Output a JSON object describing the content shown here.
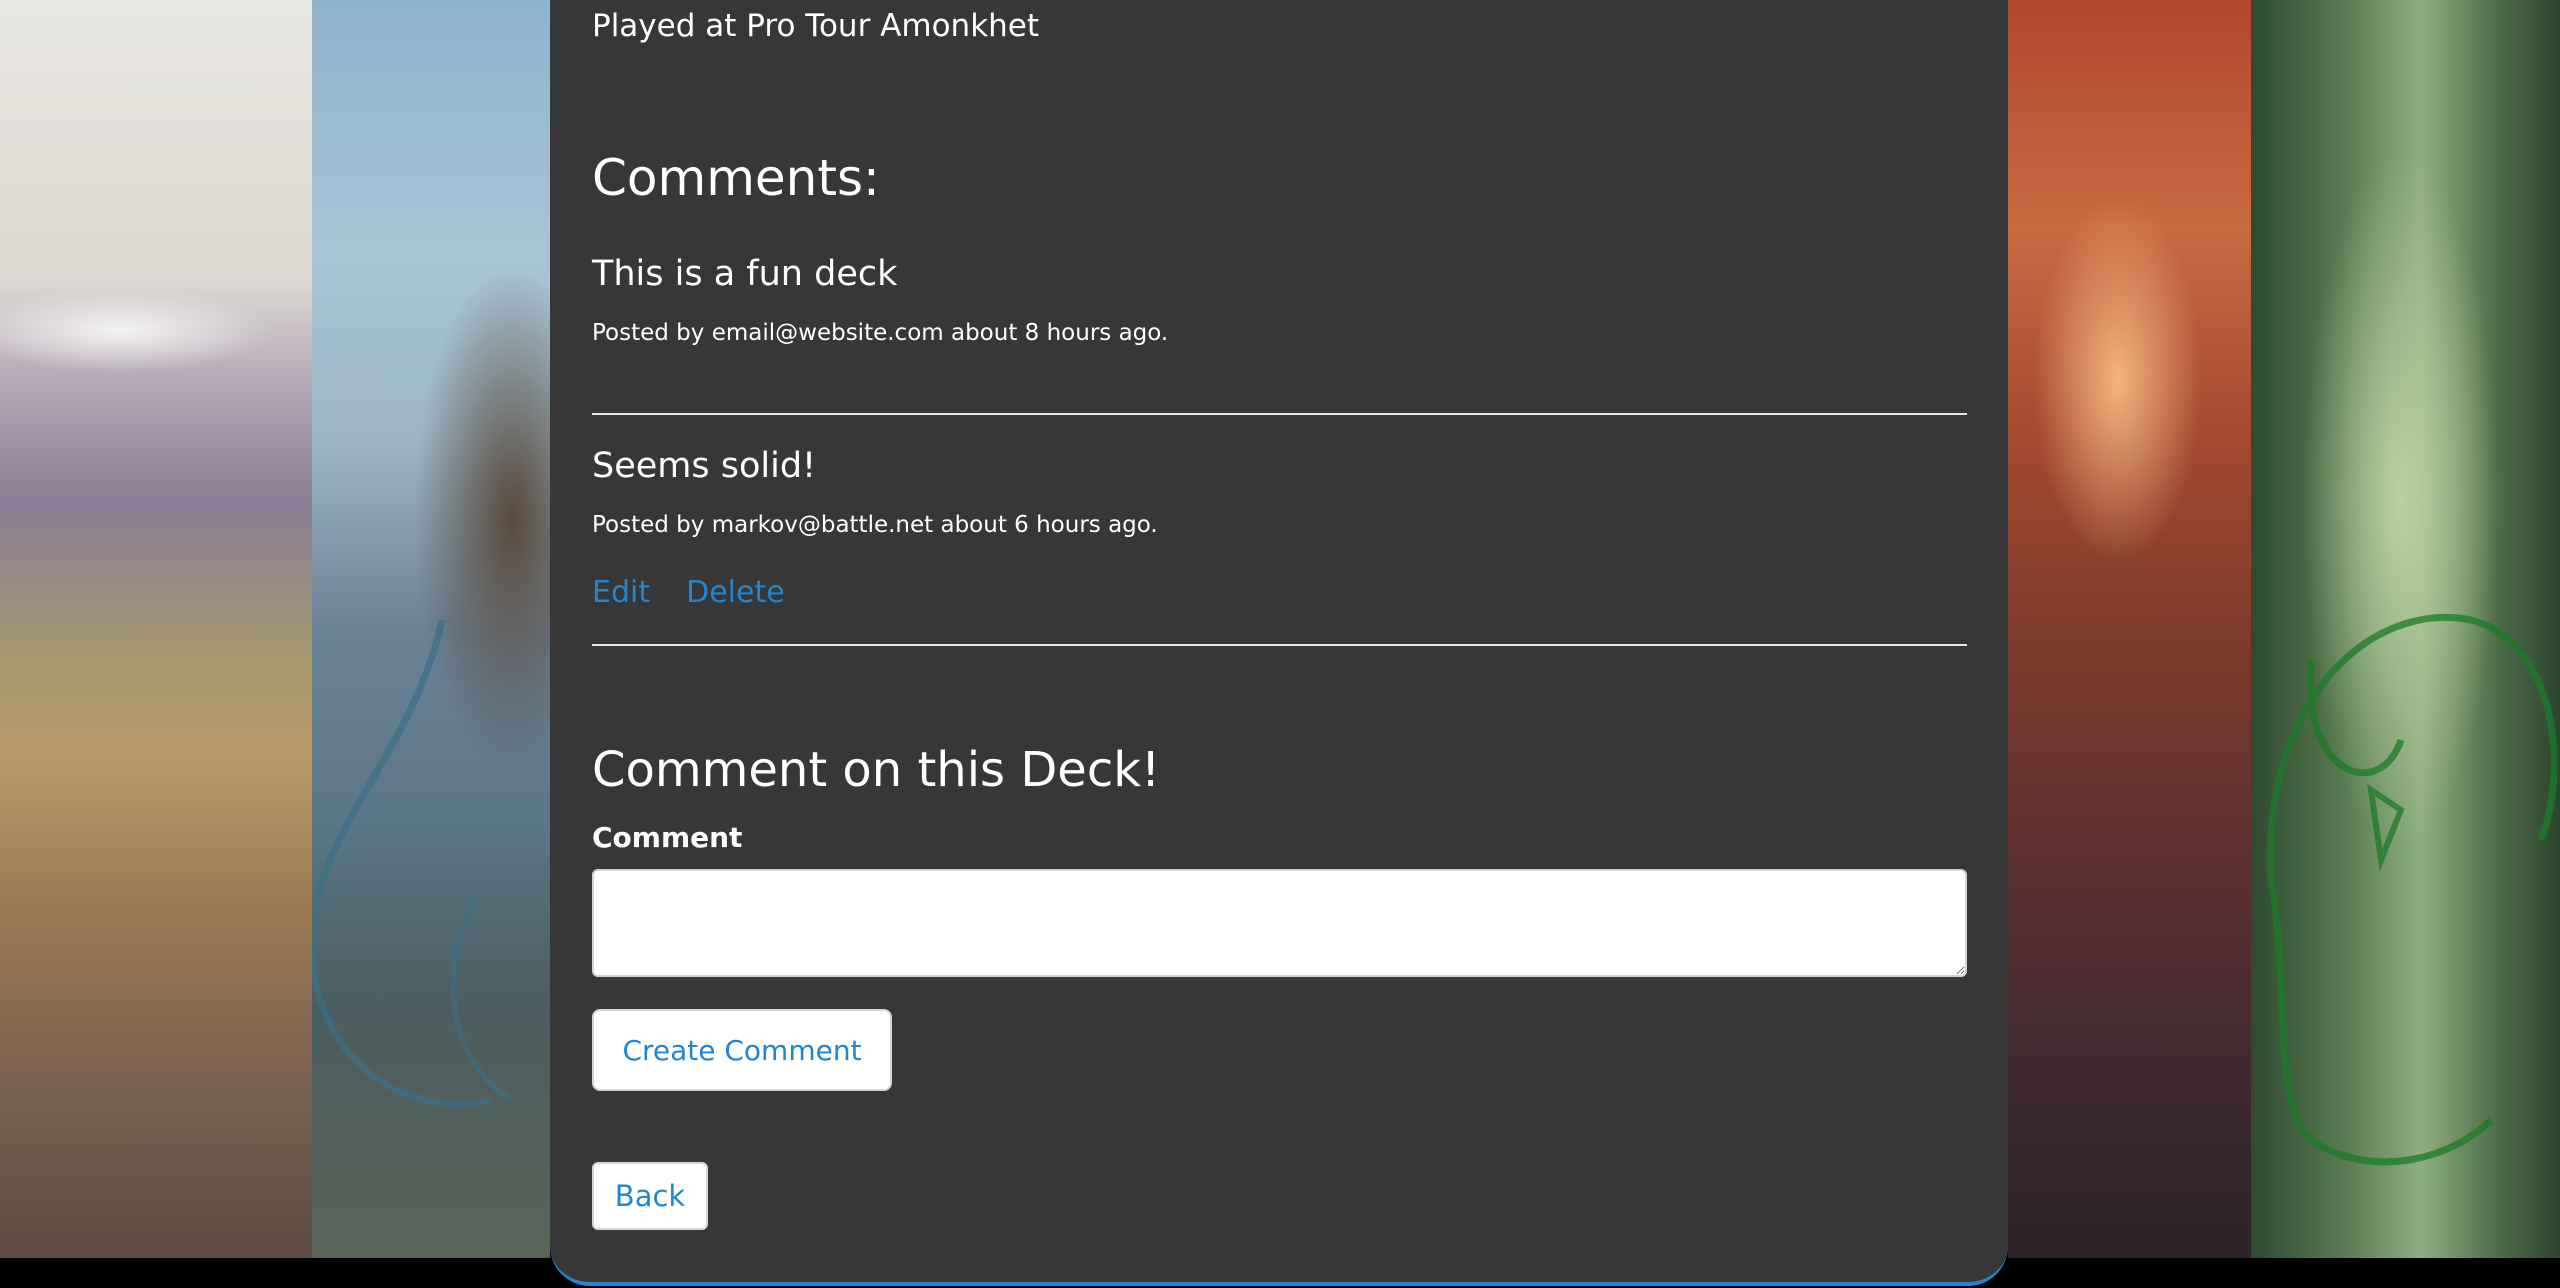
{
  "deck": {
    "played_at": "Played at Pro Tour Amonkhet"
  },
  "comments": {
    "heading": "Comments:",
    "items": [
      {
        "body": "This is a fun deck",
        "meta": "Posted by email@website.com about 8 hours ago."
      },
      {
        "body": "Seems solid!",
        "meta": "Posted by markov@battle.net about 6 hours ago.",
        "edit_label": "Edit",
        "delete_label": "Delete"
      }
    ]
  },
  "form": {
    "heading": "Comment on this Deck!",
    "comment_label": "Comment",
    "comment_value": "",
    "submit_label": "Create Comment"
  },
  "nav": {
    "back_label": "Back"
  },
  "colors": {
    "card_background": "#373737",
    "link": "#2185d0",
    "text": "#ffffff",
    "page_background": "#000000"
  }
}
